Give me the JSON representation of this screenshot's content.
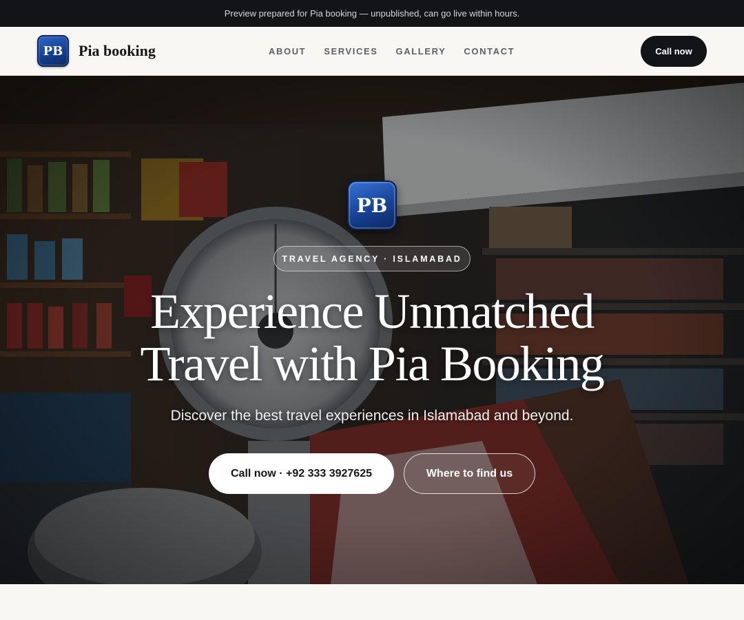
{
  "banner": {
    "text": "Preview prepared for Pia booking — unpublished, can go live within hours."
  },
  "header": {
    "logo_initials": "PB",
    "brand_name": "Pia booking",
    "nav": [
      {
        "label": "ABOUT"
      },
      {
        "label": "SERVICES"
      },
      {
        "label": "GALLERY"
      },
      {
        "label": "CONTACT"
      }
    ],
    "cta_label": "Call now"
  },
  "hero": {
    "background_image": "shop-interior-with-weighing-scale-photo",
    "logo_initials": "PB",
    "tag": "TRAVEL AGENCY · ISLAMABAD",
    "title_line1": "Experience Unmatched",
    "title_line2": "Travel with Pia Booking",
    "subtitle": "Discover the best travel experiences in Islamabad and beyond.",
    "primary_button": "Call now · +92 333 3927625",
    "secondary_button": "Where to find us"
  },
  "colors": {
    "dark": "#121417",
    "page_bg": "#f8f7f3",
    "nav_text": "#5b5f66",
    "logo_blue": "#174296",
    "white": "#ffffff"
  }
}
